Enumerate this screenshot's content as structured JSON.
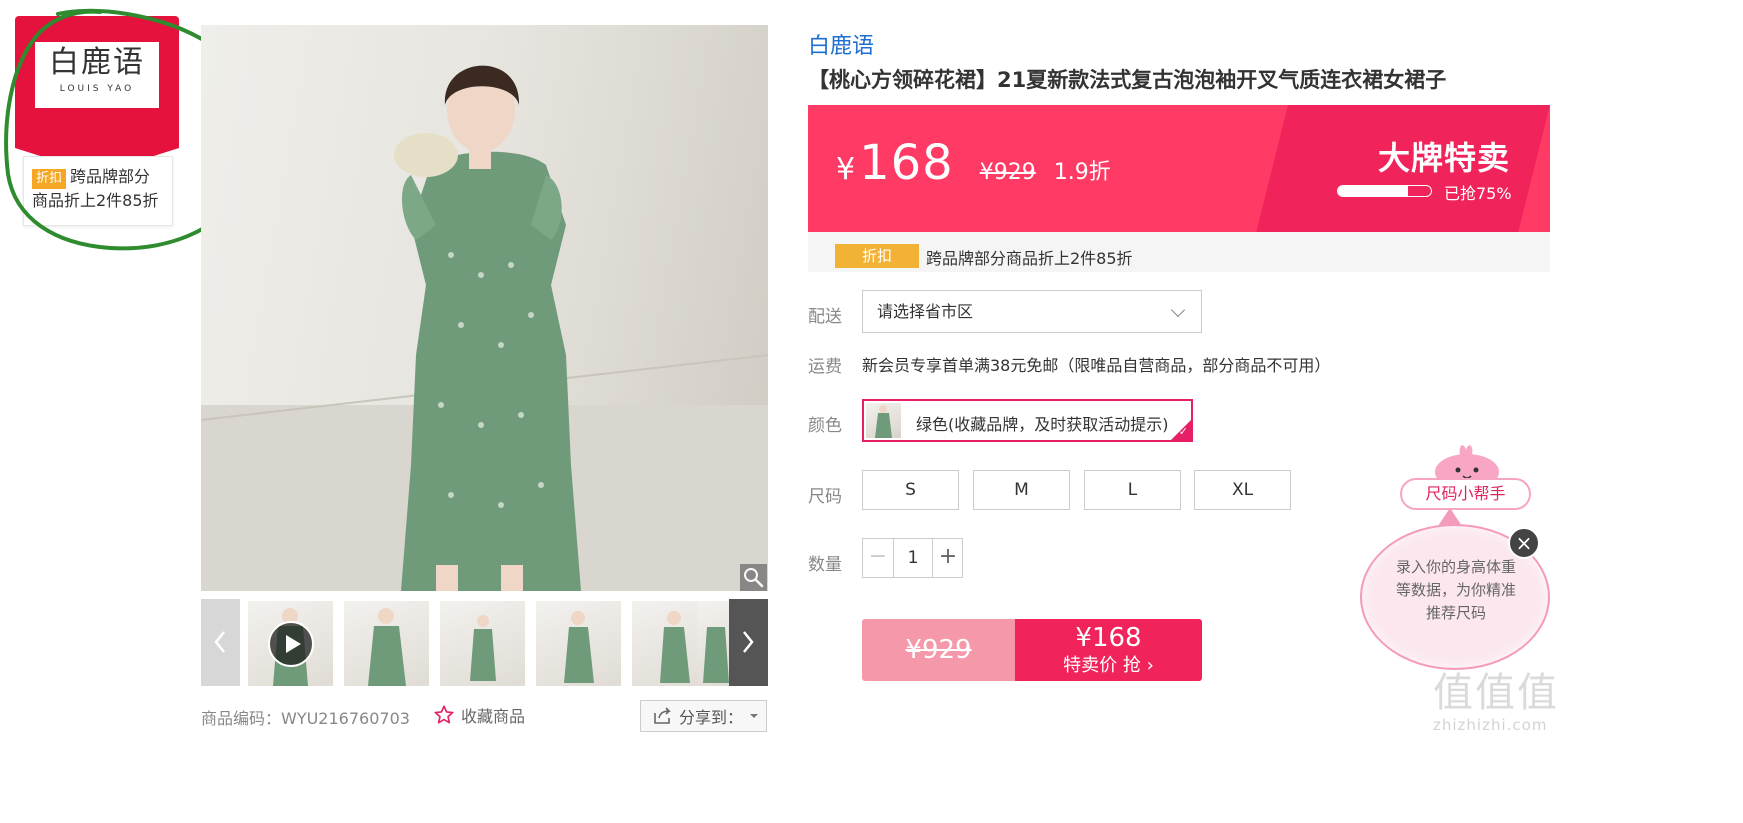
{
  "brand_card": {
    "logo_cn": "白鹿语",
    "logo_en": "LOUIS YAO",
    "tag": "折扣",
    "note": "跨品牌部分商品折上2件85折"
  },
  "gallery": {
    "thumbnail_count": 6,
    "sku_label": "商品编码：WYU216760703",
    "favorite_label": "收藏商品",
    "share_label": "分享到："
  },
  "product": {
    "brand": "白鹿语",
    "title": "【桃心方领碎花裙】21夏新款法式复古泡泡袖开叉气质连衣裙女裙子"
  },
  "price": {
    "currency": "¥",
    "current": "168",
    "original": "¥929",
    "discount": "1.9折",
    "banner": "大牌特卖",
    "sold_label": "已抢75%",
    "sold_fraction": 0.75
  },
  "promo": {
    "tag": "折扣",
    "text": "跨品牌部分商品折上2件85折"
  },
  "delivery": {
    "label": "配送",
    "select_value": "请选择省市区"
  },
  "shipping": {
    "label": "运费",
    "text": "新会员专享首单满38元免邮（限唯品自营商品，部分商品不可用）"
  },
  "color": {
    "label": "颜色",
    "option": "绿色(收藏品牌，及时获取活动提示)"
  },
  "size": {
    "label": "尺码",
    "options": [
      "S",
      "M",
      "L",
      "XL"
    ]
  },
  "quantity": {
    "label": "数量",
    "minus": "−",
    "value": "1",
    "plus": "+"
  },
  "buy": {
    "original": "¥929",
    "price": "¥168",
    "label": "特卖价 抢 ›"
  },
  "size_helper": {
    "title": "尺码小帮手",
    "text": "录入你的身高体重等数据，为你精准推荐尺码",
    "close": "×"
  },
  "watermark": {
    "big": "值值值",
    "small": "zhizhizhi.com"
  },
  "colors": {
    "accent": "#ff3a64",
    "brand_red": "#e4123c",
    "link_blue": "#1d6fd1",
    "promo_orange": "#f2b236"
  }
}
